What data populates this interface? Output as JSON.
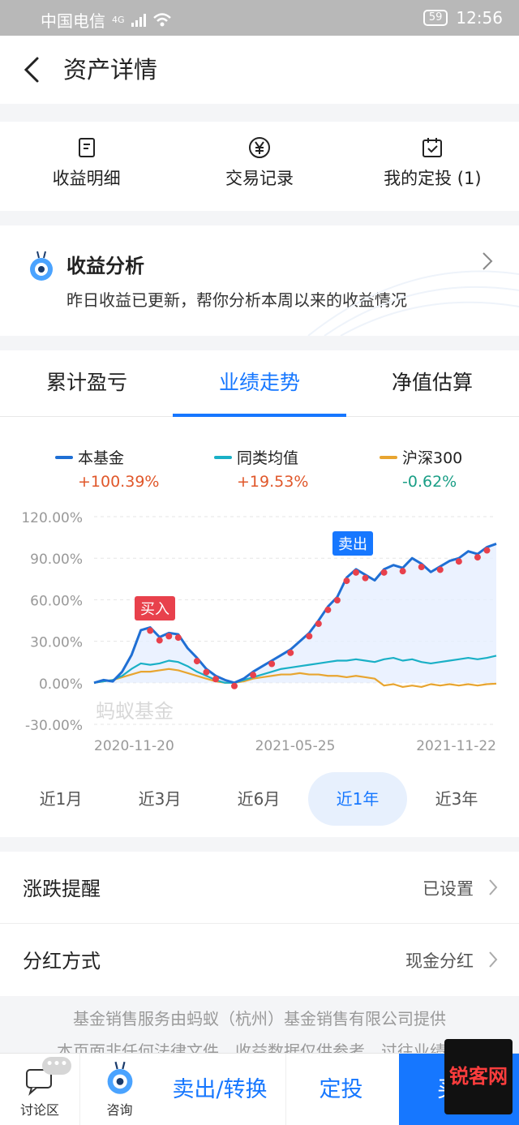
{
  "status": {
    "carrier": "中国电信",
    "network": "4G",
    "battery": "59",
    "time": "12:56"
  },
  "nav": {
    "title": "资产详情"
  },
  "quick_actions": [
    {
      "label": "收益明细",
      "icon": "document-icon"
    },
    {
      "label": "交易记录",
      "icon": "yen-icon"
    },
    {
      "label": "我的定投 (1)",
      "icon": "calendar-check-icon"
    }
  ],
  "analysis": {
    "title": "收益分析",
    "subtitle": "昨日收益已更新，帮你分析本周以来的收益情况"
  },
  "tabs": [
    "累计盈亏",
    "业绩走势",
    "净值估算"
  ],
  "active_tab": "业绩走势",
  "legend": [
    {
      "name": "本基金",
      "value": "+100.39%",
      "color": "#1f6fd4",
      "value_color": "#e0572a"
    },
    {
      "name": "同类均值",
      "value": "+19.53%",
      "color": "#1ab0c6",
      "value_color": "#e0572a"
    },
    {
      "name": "沪深300",
      "value": "-0.62%",
      "color": "#e8a530",
      "value_color": "#1a9e86"
    }
  ],
  "chart_data": {
    "type": "line",
    "ylim": [
      -30,
      120
    ],
    "y_ticks": [
      "120.00%",
      "90.00%",
      "60.00%",
      "30.00%",
      "0.00%",
      "-30.00%"
    ],
    "x_ticks": [
      "2020-11-20",
      "2021-05-25",
      "2021-11-22"
    ],
    "watermark": "蚂蚁基金",
    "annotations": [
      {
        "label": "买入",
        "color": "#e8414c"
      },
      {
        "label": "卖出",
        "color": "#1677ff"
      }
    ],
    "series": [
      {
        "name": "本基金",
        "color": "#1f6fd4",
        "values": [
          0,
          2,
          1,
          8,
          20,
          38,
          40,
          33,
          36,
          35,
          25,
          18,
          10,
          5,
          2,
          0,
          3,
          8,
          12,
          16,
          20,
          24,
          30,
          36,
          45,
          55,
          62,
          76,
          82,
          78,
          74,
          82,
          85,
          83,
          90,
          86,
          80,
          84,
          88,
          90,
          95,
          93,
          98,
          100.39
        ]
      },
      {
        "name": "同类均值",
        "color": "#1ab0c6",
        "values": [
          0,
          1,
          2,
          5,
          10,
          14,
          13,
          14,
          16,
          15,
          12,
          8,
          5,
          2,
          0,
          0,
          2,
          4,
          6,
          8,
          10,
          11,
          12,
          13,
          14,
          15,
          16,
          16,
          17,
          16,
          15,
          17,
          18,
          16,
          17,
          15,
          14,
          15,
          16,
          17,
          18,
          17,
          18,
          19.53
        ]
      },
      {
        "name": "沪深300",
        "color": "#e8a530",
        "values": [
          0,
          1,
          2,
          4,
          6,
          8,
          8,
          9,
          10,
          9,
          7,
          5,
          3,
          1,
          0,
          0,
          1,
          3,
          4,
          5,
          6,
          6,
          7,
          6,
          6,
          5,
          5,
          4,
          5,
          4,
          3,
          -2,
          -1,
          -3,
          -2,
          -3,
          -1,
          -2,
          -1,
          -2,
          -1,
          -2,
          -1,
          -0.62
        ]
      }
    ]
  },
  "periods": [
    "近1月",
    "近3月",
    "近6月",
    "近1年",
    "近3年"
  ],
  "active_period": "近1年",
  "settings": [
    {
      "label": "涨跌提醒",
      "value": "已设置"
    },
    {
      "label": "分红方式",
      "value": "现金分红"
    }
  ],
  "footer": {
    "line1": "基金销售服务由蚂蚁（杭州）基金销售有限公司提供",
    "line2": "本页面非任何法律文件，收益数据仅供参考，过往业绩不"
  },
  "bottom_bar": {
    "discuss": "讨论区",
    "badge": "•••",
    "consult": "咨询",
    "sell": "卖出/转换",
    "sip": "定投",
    "buy": "买入",
    "watermark": "锐客网"
  }
}
